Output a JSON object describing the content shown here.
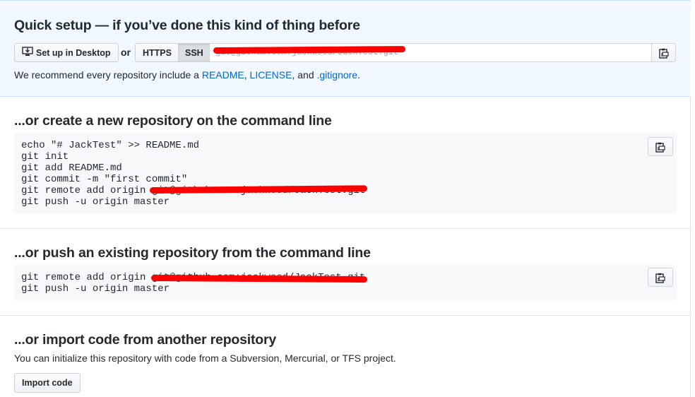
{
  "quick_setup": {
    "title": "Quick setup — if you’ve done this kind of thing before",
    "desktop_button": "Set up in Desktop",
    "or_label": "or",
    "https_label": "HTTPS",
    "ssh_label": "SSH",
    "clone_url": "git@github.com:jackwood/JackTest.git",
    "recommend_prefix": "We recommend every repository include a ",
    "readme_link": "README",
    "sep1": ", ",
    "license_link": "LICENSE",
    "sep2": ", and ",
    "gitignore_link": ".gitignore",
    "recommend_suffix": "."
  },
  "create_new": {
    "title": "...or create a new repository on the command line",
    "code_lines": [
      "echo \"# JackTest\" >> README.md",
      "git init",
      "git add README.md",
      "git commit -m \"first commit\"",
      "git remote add origin git@github.com:jackwood/JackTest.git",
      "git push -u origin master"
    ]
  },
  "push_existing": {
    "title": "...or push an existing repository from the command line",
    "code_lines": [
      "git remote add origin git@github.com:jackwood/JackTest.git",
      "git push -u origin master"
    ]
  },
  "import_code": {
    "title": "...or import code from another repository",
    "description": "You can initialize this repository with code from a Subversion, Mercurial, or TFS project.",
    "button": "Import code"
  },
  "icons": {
    "desktop": "desktop-download-icon",
    "clipboard": "clipboard-icon"
  },
  "colors": {
    "quick_bg": "#f1f8ff",
    "link": "#0366d6",
    "redaction": "#ff0000"
  }
}
